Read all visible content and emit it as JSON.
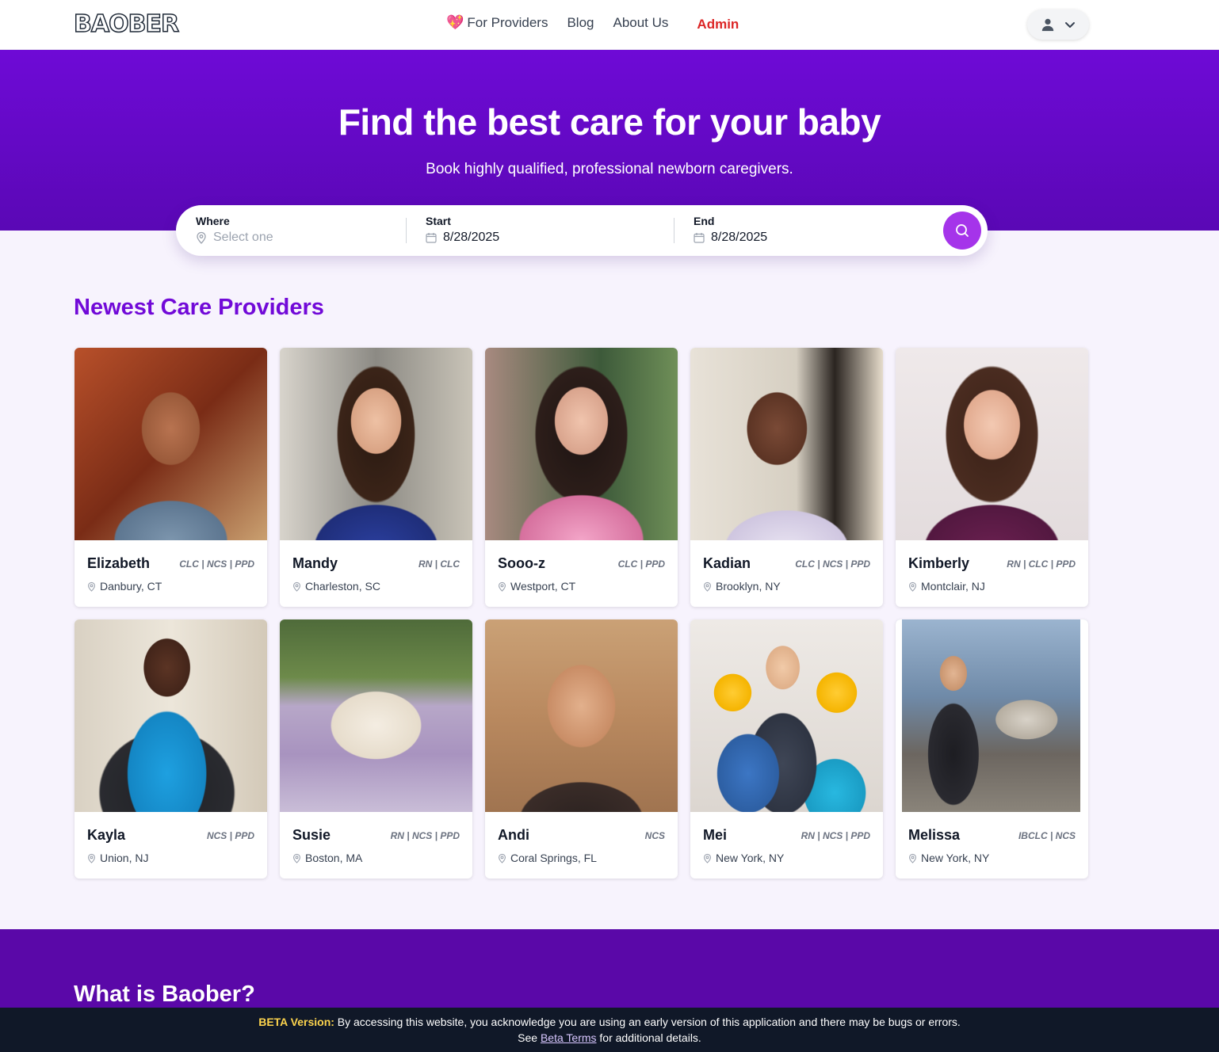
{
  "nav": {
    "logo": "BAOBER",
    "links": [
      {
        "label": "For Providers"
      },
      {
        "label": "Blog"
      },
      {
        "label": "About Us"
      }
    ],
    "admin": "Admin"
  },
  "hero": {
    "title": "Find the best care for your baby",
    "subtitle": "Book highly qualified, professional newborn caregivers."
  },
  "search": {
    "where_label": "Where",
    "where_placeholder": "Select one",
    "start_label": "Start",
    "start_value": "8/28/2025",
    "end_label": "End",
    "end_value": "8/28/2025"
  },
  "providers_title": "Newest Care Providers",
  "providers": [
    {
      "name": "Elizabeth",
      "creds": "CLC | NCS | PPD",
      "location": "Danbury, CT"
    },
    {
      "name": "Mandy",
      "creds": "RN | CLC",
      "location": "Charleston, SC"
    },
    {
      "name": "Sooo-z",
      "creds": "CLC | PPD",
      "location": "Westport, CT"
    },
    {
      "name": "Kadian",
      "creds": "CLC | NCS | PPD",
      "location": "Brooklyn, NY"
    },
    {
      "name": "Kimberly",
      "creds": "RN | CLC | PPD",
      "location": "Montclair, NJ"
    },
    {
      "name": "Kayla",
      "creds": "NCS | PPD",
      "location": "Union, NJ"
    },
    {
      "name": "Susie",
      "creds": "RN | NCS | PPD",
      "location": "Boston, MA"
    },
    {
      "name": "Andi",
      "creds": "NCS",
      "location": "Coral Springs, FL"
    },
    {
      "name": "Mei",
      "creds": "RN | NCS | PPD",
      "location": "New York, NY"
    },
    {
      "name": "Melissa",
      "creds": "IBCLC | NCS",
      "location": "New York, NY"
    }
  ],
  "what_title": "What is Baober?",
  "beta": {
    "tag": "BETA Version:",
    "text": "By accessing this website, you acknowledge you are using an early version of this application and there may be bugs or errors.",
    "see": "See",
    "link": "Beta Terms",
    "after": "for additional details."
  },
  "colors": {
    "brand_purple": "#7109d8",
    "hero_top": "#6e0ad6",
    "search_button": "#a534ea",
    "admin_red": "#dc2626"
  }
}
